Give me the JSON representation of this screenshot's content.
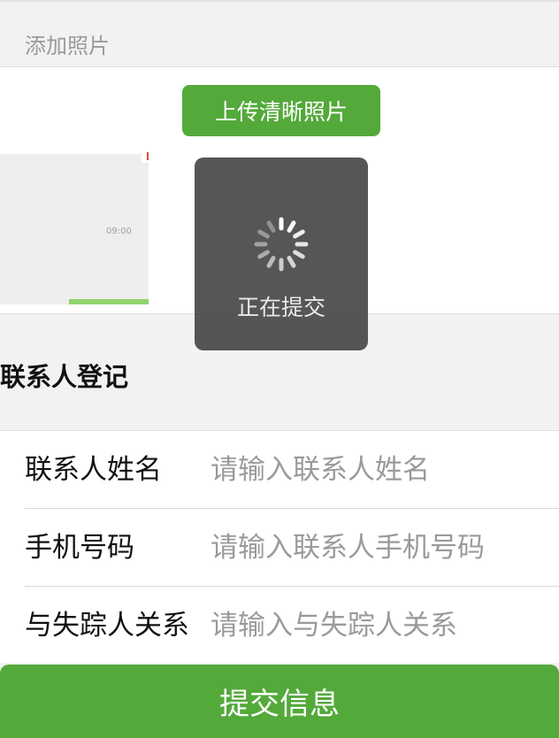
{
  "photo_section": {
    "title": "添加照片",
    "upload_button": "上传清晰照片",
    "thumbnail_time": "09:00"
  },
  "contact_section": {
    "title": "联系人登记",
    "fields": [
      {
        "label": "联系人姓名",
        "placeholder": "请输入联系人姓名",
        "value": ""
      },
      {
        "label": "手机号码",
        "placeholder": "请输入联系人手机号码",
        "value": ""
      },
      {
        "label": "与失踪人关系",
        "placeholder": "请输入与失踪人关系",
        "value": ""
      }
    ]
  },
  "submit_button": "提交信息",
  "loading_toast": {
    "message": "正在提交"
  },
  "colors": {
    "accent": "#53a93a",
    "toast_bg": "#484848",
    "page_bg": "#f2f2f2"
  }
}
